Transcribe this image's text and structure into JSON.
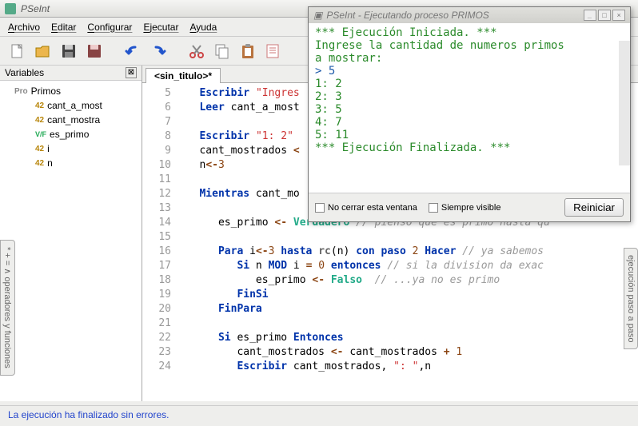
{
  "titlebar": {
    "title": "PSeInt"
  },
  "menubar": {
    "items": [
      "Archivo",
      "Editar",
      "Configurar",
      "Ejecutar",
      "Ayuda"
    ]
  },
  "var_panel": {
    "title": "Variables",
    "root": "Primos",
    "vars": [
      {
        "badge": "42",
        "cls": "num",
        "name": "cant_a_most"
      },
      {
        "badge": "42",
        "cls": "num",
        "name": "cant_mostra"
      },
      {
        "badge": "V/F",
        "cls": "vf",
        "name": "es_primo"
      },
      {
        "badge": "42",
        "cls": "num",
        "name": "i"
      },
      {
        "badge": "42",
        "cls": "num",
        "name": "n"
      }
    ]
  },
  "tab": {
    "label": "<sin_titulo>*"
  },
  "side_tabs": {
    "left": "* + = ∧ operadores y funciones",
    "right": "ejecución paso a paso"
  },
  "statusbar": {
    "text": "La ejecución ha finalizado sin errores."
  },
  "exec_window": {
    "title": "PSeInt - Ejecutando proceso PRIMOS",
    "lines": [
      {
        "cls": "exec-green",
        "text": "*** Ejecución Iniciada. ***"
      },
      {
        "cls": "exec-green",
        "text": "Ingrese la cantidad de numeros primos"
      },
      {
        "cls": "exec-green",
        "text": "a mostrar:"
      },
      {
        "cls": "exec-blue",
        "text": "> 5"
      },
      {
        "cls": "exec-green",
        "text": "1: 2"
      },
      {
        "cls": "exec-green",
        "text": "2: 3"
      },
      {
        "cls": "exec-green",
        "text": "3: 5"
      },
      {
        "cls": "exec-green",
        "text": "4: 7"
      },
      {
        "cls": "exec-green",
        "text": "5: 11"
      },
      {
        "cls": "exec-green",
        "text": "*** Ejecución Finalizada. ***"
      }
    ],
    "chk1": "No cerrar esta ventana",
    "chk2": "Siempre visible",
    "restart": "Reiniciar"
  },
  "code_lines": [
    {
      "n": 5,
      "h": "<span class='kw'>Escribir</span> <span class='str'>\"Ingres</span>"
    },
    {
      "n": 6,
      "h": "<span class='kw'>Leer</span> cant_a_most"
    },
    {
      "n": 7,
      "h": ""
    },
    {
      "n": 8,
      "h": "<span class='kw'>Escribir</span> <span class='str'>\"1: 2\"</span>"
    },
    {
      "n": 9,
      "h": "cant_mostrados <span class='op'>&lt;</span>"
    },
    {
      "n": 10,
      "h": "n<span class='op'>&lt;-</span><span class='num'>3</span>"
    },
    {
      "n": 11,
      "h": ""
    },
    {
      "n": 12,
      "h": "<span class='kw'>Mientras</span> cant_mo"
    },
    {
      "n": 13,
      "h": ""
    },
    {
      "n": 14,
      "h": "   es_primo <span class='op'>&lt;-</span> <span class='val'>Verdadero</span> <span class='cmt'>// pienso que es primo hasta qu</span>"
    },
    {
      "n": 15,
      "h": ""
    },
    {
      "n": 16,
      "h": "   <span class='kw'>Para</span> i<span class='op'>&lt;-</span><span class='num'>3</span> <span class='kw'>hasta</span> <span class='fn'>rc</span>(n) <span class='kw'>con paso</span> <span class='num'>2</span> <span class='kw'>Hacer</span> <span class='cmt'>// ya sabemos</span>"
    },
    {
      "n": 17,
      "h": "      <span class='kw'>Si</span> n <span class='kw'>MOD</span> i <span class='op'>=</span> <span class='num'>0</span> <span class='kw'>entonces</span> <span class='cmt'>// si la division da exac</span>"
    },
    {
      "n": 18,
      "h": "         es_primo <span class='op'>&lt;-</span> <span class='val'>Falso</span>  <span class='cmt'>// ...ya no es primo</span>"
    },
    {
      "n": 19,
      "h": "      <span class='kw'>FinSi</span>"
    },
    {
      "n": 20,
      "h": "   <span class='kw'>FinPara</span>"
    },
    {
      "n": 21,
      "h": ""
    },
    {
      "n": 22,
      "h": "   <span class='kw'>Si</span> es_primo <span class='kw'>Entonces</span>"
    },
    {
      "n": 23,
      "h": "      cant_mostrados <span class='op'>&lt;-</span> cant_mostrados <span class='op'>+</span> <span class='num'>1</span>"
    },
    {
      "n": 24,
      "h": "      <span class='kw'>Escribir</span> cant_mostrados, <span class='str'>\": \"</span>,n"
    }
  ]
}
